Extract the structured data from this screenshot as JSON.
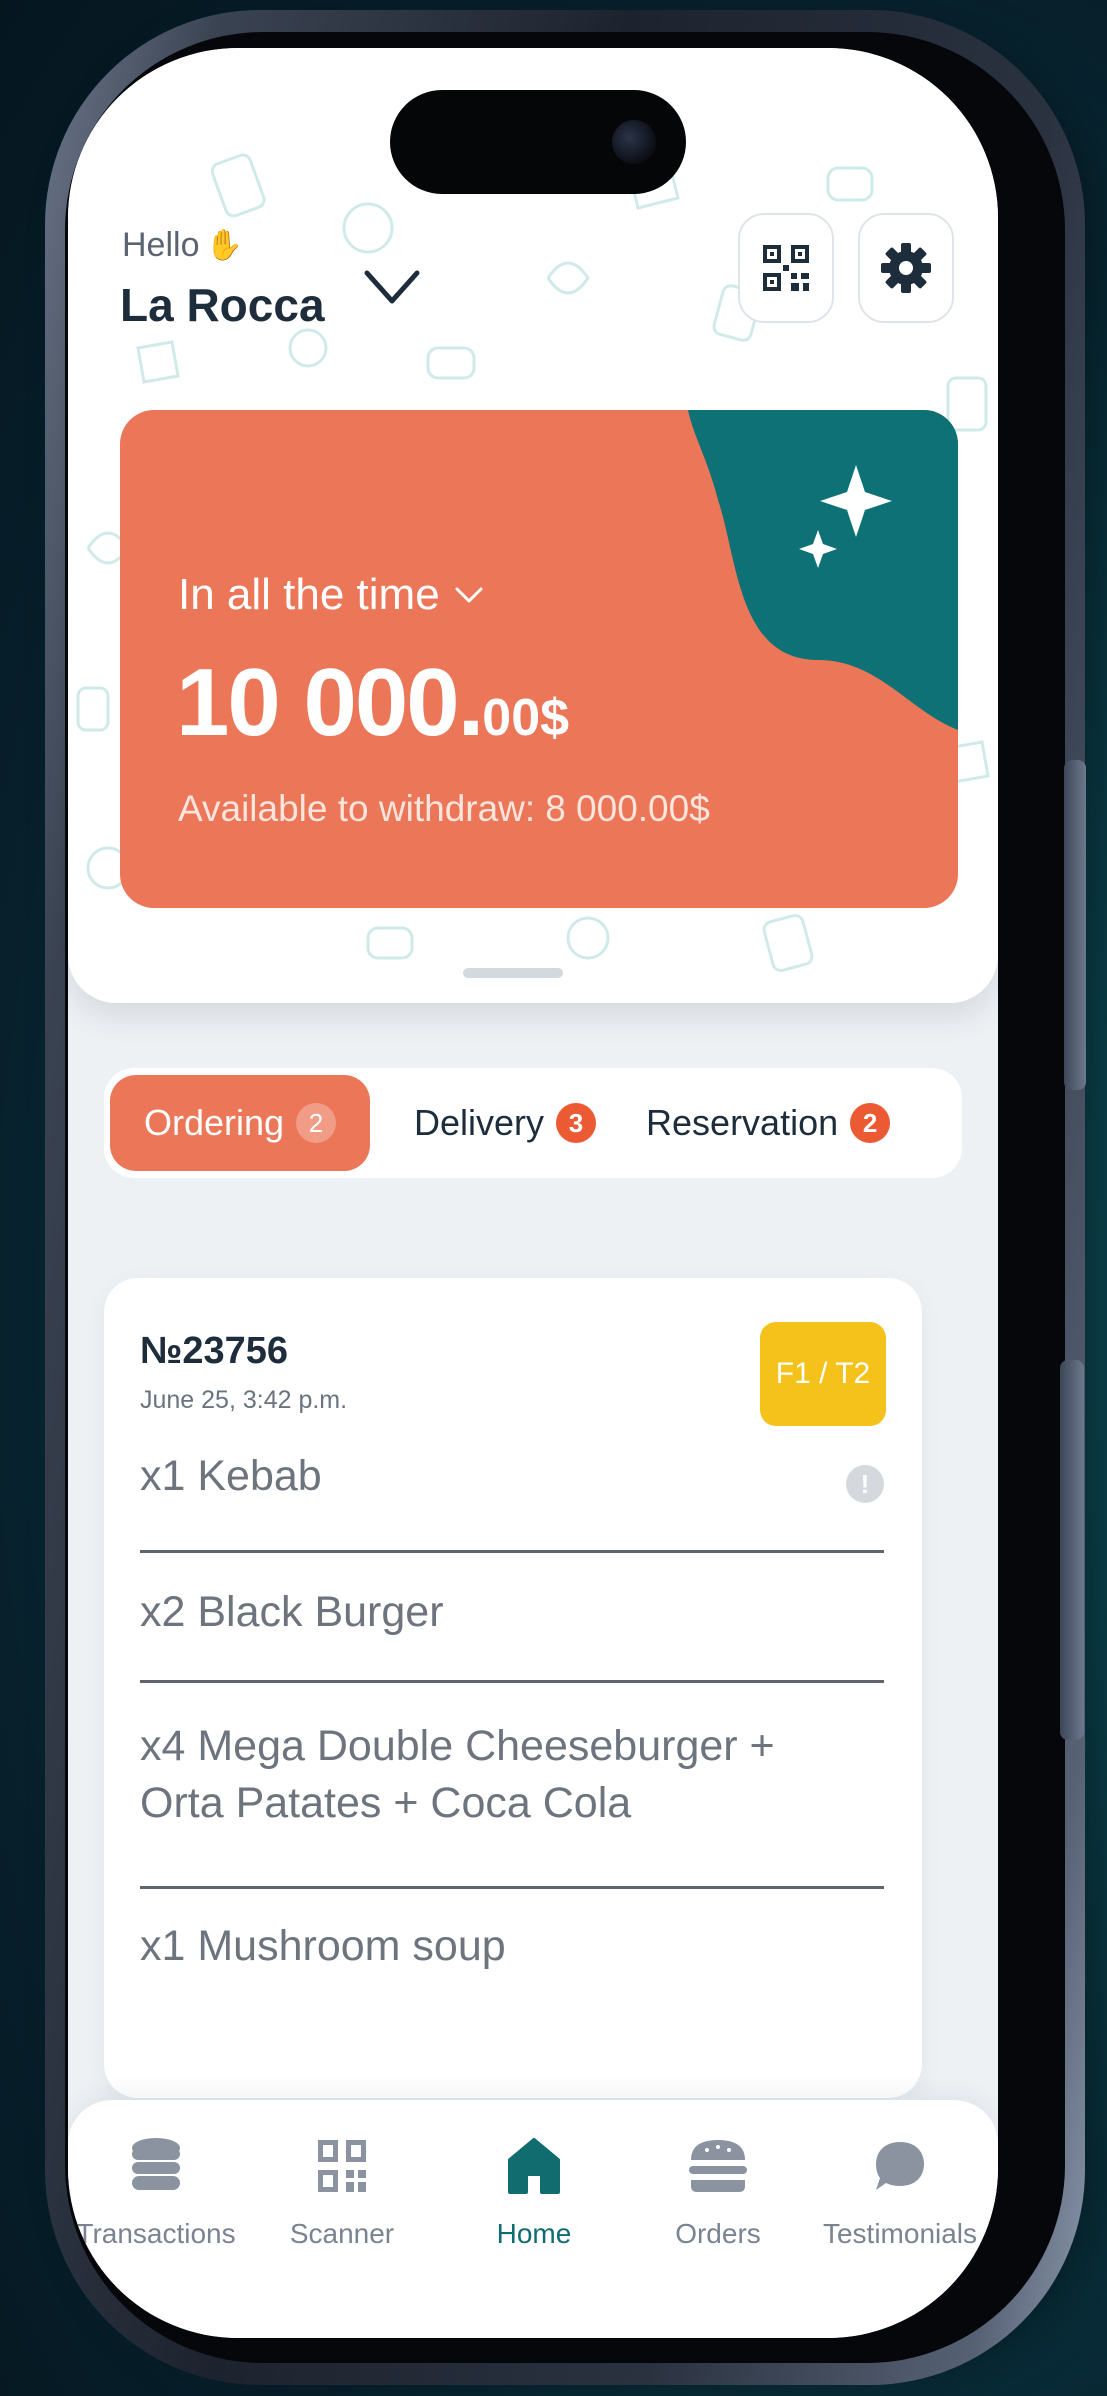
{
  "header": {
    "greeting": "Hello",
    "greeting_emoji": "wave-hand-icon",
    "venue_name": "La Rocca",
    "qr_button_icon": "qr-code-icon",
    "settings_button_icon": "gear-icon"
  },
  "balance": {
    "period_label": "In all the time",
    "amount_main": "10 000.",
    "amount_cents": "00$",
    "withdraw_label": "Available to withdraw:",
    "withdraw_value": "8 000.00$"
  },
  "tabs": [
    {
      "label": "Ordering",
      "count": "2",
      "active": true
    },
    {
      "label": "Delivery",
      "count": "3",
      "active": false
    },
    {
      "label": "Reservation",
      "count": "2",
      "active": false
    }
  ],
  "order": {
    "number": "№23756",
    "date": "June 25, 3:42 p.m.",
    "table": "F1 / T2",
    "items": [
      "x1 Kebab",
      "x2 Black Burger",
      "x4 Mega Double Cheeseburger + Orta Patates + Coca Cola",
      "x1 Mushroom soup"
    ]
  },
  "nav": [
    {
      "label": "Transactions",
      "icon": "coins-icon"
    },
    {
      "label": "Scanner",
      "icon": "qr-code-icon"
    },
    {
      "label": "Home",
      "icon": "home-icon",
      "active": true
    },
    {
      "label": "Orders",
      "icon": "burger-icon"
    },
    {
      "label": "Testimonials",
      "icon": "chat-bubble-icon"
    }
  ],
  "colors": {
    "accent": "#ec7658",
    "teal": "#106c6f",
    "badge": "#ec5a33",
    "table_badge": "#f5c21b",
    "background": "#eef1f4"
  }
}
